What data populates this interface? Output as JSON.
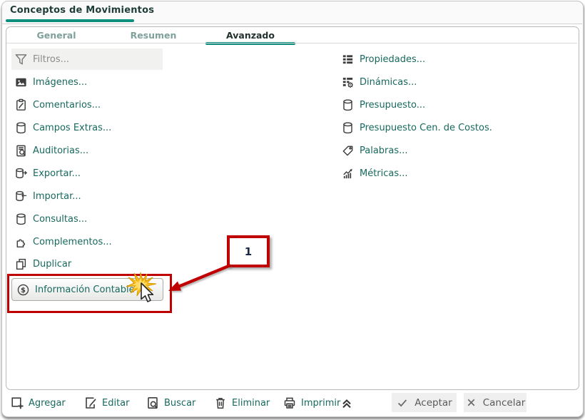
{
  "window": {
    "title": "Conceptos de Movimientos"
  },
  "tabs": [
    {
      "label": "General",
      "active": false
    },
    {
      "label": "Resumen",
      "active": false
    },
    {
      "label": "Avanzado",
      "active": true
    }
  ],
  "menu": {
    "left": [
      {
        "label": "Filtros...",
        "icon": "funnel-icon",
        "state": "hovered"
      },
      {
        "label": "Imágenes...",
        "icon": "image-icon"
      },
      {
        "label": "Comentarios...",
        "icon": "clipboard-pencil-icon"
      },
      {
        "label": "Campos Extras...",
        "icon": "database-icon"
      },
      {
        "label": "Auditorias...",
        "icon": "document-search-icon"
      },
      {
        "label": "Exportar...",
        "icon": "database-export-icon"
      },
      {
        "label": "Importar...",
        "icon": "database-import-icon"
      },
      {
        "label": "Consultas...",
        "icon": "database-icon"
      },
      {
        "label": "Complementos...",
        "icon": "puzzle-icon"
      },
      {
        "label": "Duplicar",
        "icon": "copy-icon"
      },
      {
        "label": "Información Contable",
        "icon": "dollar-circle-icon",
        "state": "highlighted-step-1"
      }
    ],
    "right": [
      {
        "label": "Propiedades...",
        "icon": "grid-icon"
      },
      {
        "label": "Dinámicas...",
        "icon": "grid-gear-icon"
      },
      {
        "label": "Presupuesto...",
        "icon": "database-icon"
      },
      {
        "label": "Presupuesto Cen. de Costos.",
        "icon": "database-icon"
      },
      {
        "label": "Palabras...",
        "icon": "tag-icon"
      },
      {
        "label": "Métricas...",
        "icon": "metrics-icon"
      }
    ]
  },
  "callout": {
    "number": "1"
  },
  "toolbar": {
    "actions": [
      {
        "label": "Agregar",
        "icon": "add-icon"
      },
      {
        "label": "Editar",
        "icon": "edit-icon"
      },
      {
        "label": "Buscar",
        "icon": "search-icon"
      },
      {
        "label": "Eliminar",
        "icon": "trash-icon"
      },
      {
        "label": "Imprimir",
        "icon": "printer-icon"
      }
    ],
    "collapse_icon": "chevron-double-up-icon",
    "accept_label": "Aceptar",
    "cancel_label": "Cancelar"
  },
  "colors": {
    "accent_teal": "#0E8E7D",
    "link_teal": "#17695E",
    "tab_inactive": "#7FA09B",
    "highlight_red": "#C00000",
    "icon_gray": "#3D3D3D",
    "disabled_button_bg": "#EFEFEF"
  }
}
